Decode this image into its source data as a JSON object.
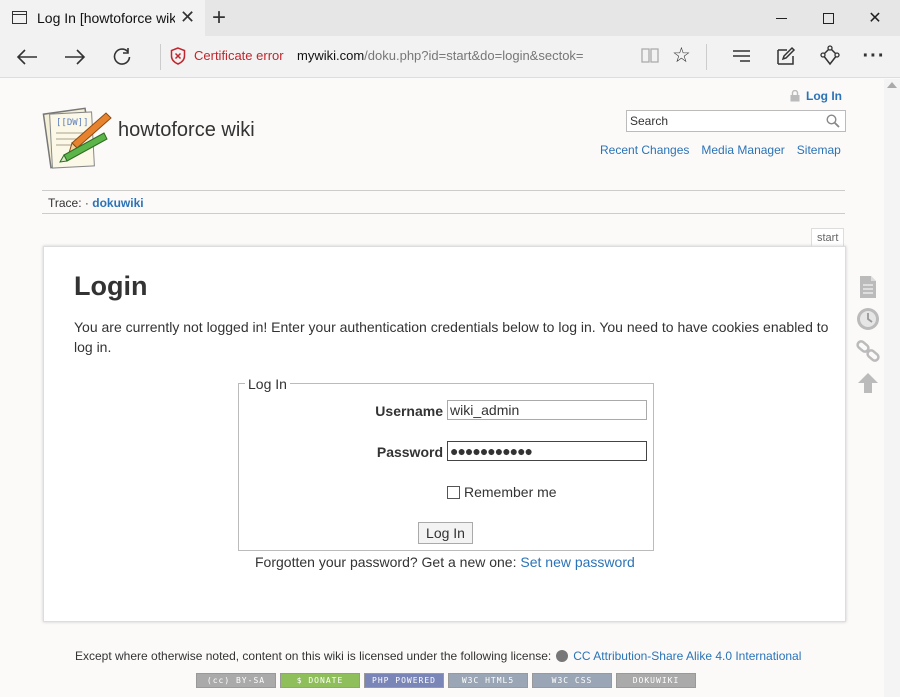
{
  "browser": {
    "tab_title": "Log In [howtoforce wiki",
    "cert_error": "Certificate error",
    "url_domain": "mywiki.com",
    "url_path": "/doku.php?id=start&do=login&sectok="
  },
  "header": {
    "site_title": "howtoforce wiki",
    "login_link": "Log In",
    "search_placeholder": "Search",
    "links": [
      "Recent Changes",
      "Media Manager",
      "Sitemap"
    ]
  },
  "breadcrumb": {
    "label": "Trace:",
    "separator": "·",
    "item": "dokuwiki"
  },
  "page_id": "start",
  "main": {
    "heading": "Login",
    "intro": "You are currently not logged in! Enter your authentication credentials below to log in. You need to have cookies enabled to log in.",
    "form": {
      "legend": "Log In",
      "username_label": "Username",
      "username_value": "wiki_admin",
      "password_label": "Password",
      "password_value": "●●●●●●●●●●●",
      "remember_label": "Remember me",
      "remember_checked": false,
      "submit_label": "Log In"
    },
    "forgot_text": "Forgotten your password? Get a new one:",
    "forgot_link": "Set new password"
  },
  "footer": {
    "license_text": "Except where otherwise noted, content on this wiki is licensed under the following license:",
    "license_link": "CC Attribution-Share Alike 4.0 International",
    "badges": [
      {
        "label": "(cc) BY-SA",
        "color": "#aaaaaa"
      },
      {
        "label": "$ DONATE",
        "color": "#8fbf5a"
      },
      {
        "label": "PHP POWERED",
        "color": "#7a86b8"
      },
      {
        "label": "W3C HTML5",
        "color": "#9aa6b5"
      },
      {
        "label": "W3C CSS",
        "color": "#9aa6b5"
      },
      {
        "label": "DOKUWIKI",
        "color": "#aaaaaa"
      }
    ]
  },
  "colors": {
    "link": "#2b73b7",
    "cert_error": "#c0262d"
  }
}
